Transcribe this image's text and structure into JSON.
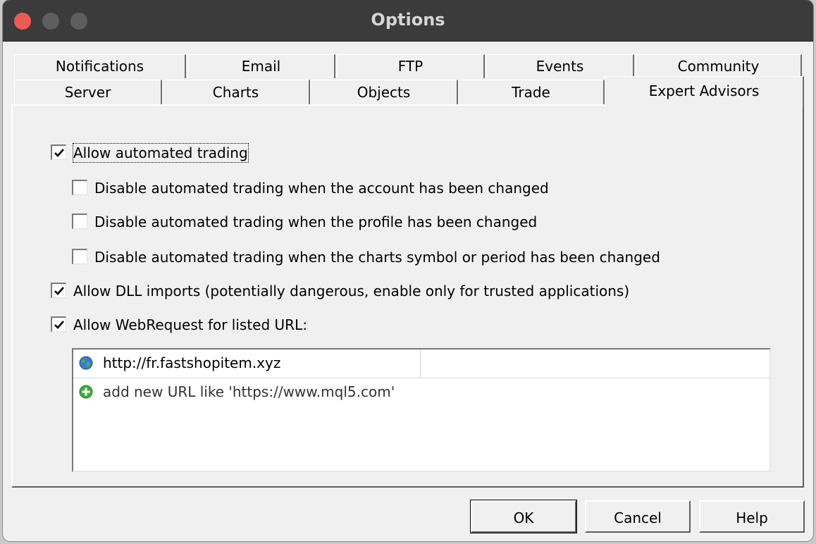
{
  "window": {
    "title": "Options"
  },
  "tabs": {
    "row1": [
      "Notifications",
      "Email",
      "FTP",
      "Events",
      "Community"
    ],
    "row2": [
      "Server",
      "Charts",
      "Objects",
      "Trade",
      "Expert Advisors"
    ],
    "active": "Expert Advisors"
  },
  "options": {
    "allow_automated": {
      "label": "Allow automated trading",
      "checked": true
    },
    "disable_account": {
      "label": "Disable automated trading when the account has been changed",
      "checked": false
    },
    "disable_profile": {
      "label": "Disable automated trading when the profile has been changed",
      "checked": false
    },
    "disable_symbol": {
      "label": "Disable automated trading when the charts symbol or period has been changed",
      "checked": false
    },
    "allow_dll": {
      "label": "Allow DLL imports (potentially dangerous, enable only for trusted applications)",
      "checked": true
    },
    "allow_webrequest": {
      "label": "Allow WebRequest for listed URL:",
      "checked": true
    }
  },
  "url_list": {
    "items": [
      "http://fr.fastshopitem.xyz"
    ],
    "add_placeholder": "add new URL like 'https://www.mql5.com'"
  },
  "buttons": {
    "ok": "OK",
    "cancel": "Cancel",
    "help": "Help"
  },
  "icons": {
    "globe": "globe-icon",
    "add": "plus-circle-icon"
  }
}
